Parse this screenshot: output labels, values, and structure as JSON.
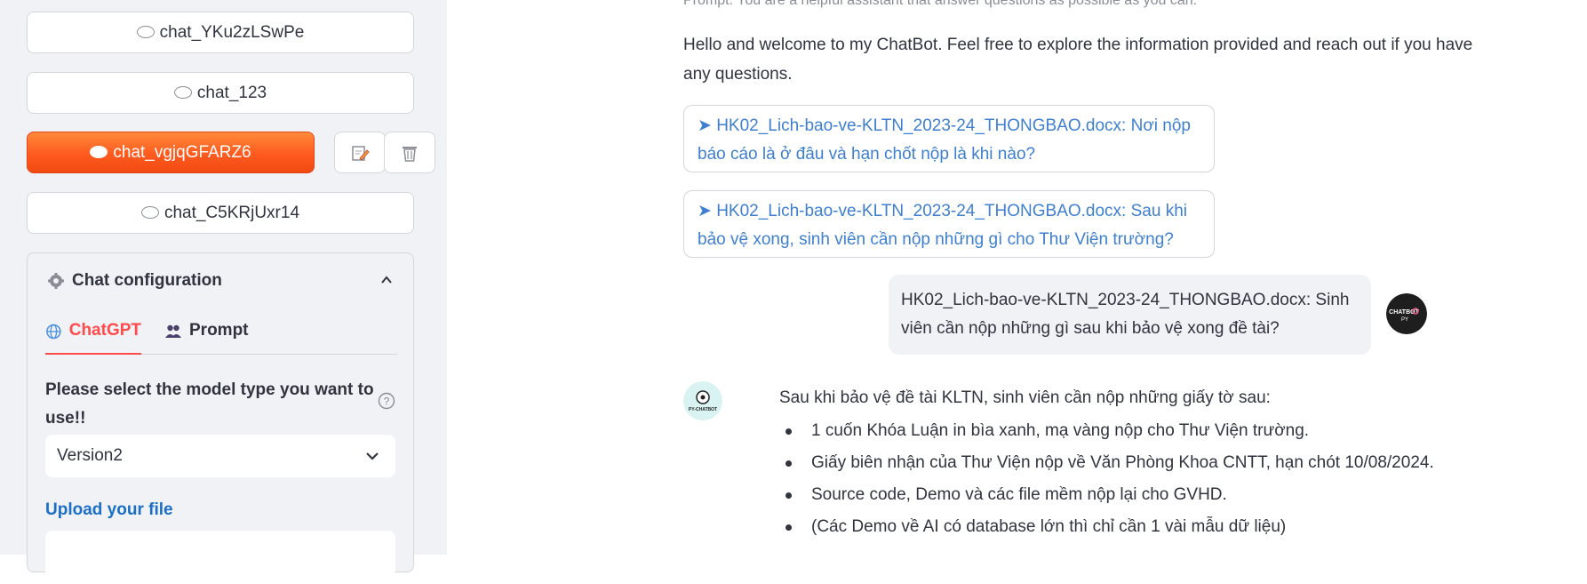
{
  "sidebar": {
    "chats": [
      {
        "label": "chat_YKu2zLSwPe",
        "active": false
      },
      {
        "label": "chat_123",
        "active": false
      },
      {
        "label": "chat_vgjqGFARZ6",
        "active": true
      },
      {
        "label": "chat_C5KRjUxr14",
        "active": false
      }
    ],
    "config": {
      "title": "Chat configuration",
      "tabs": [
        {
          "label": "ChatGPT",
          "icon": "globe-icon",
          "active": true
        },
        {
          "label": "Prompt",
          "icon": "users-icon",
          "active": false
        }
      ],
      "model_label": "Please select the model type you want to use!!",
      "model_value": "Version2",
      "upload_label": "Upload your file"
    }
  },
  "main": {
    "prompt_line": "Prompt: You are a helpful assistant that answer questions as possible as you can.",
    "welcome": "Hello and welcome to my ChatBot. Feel free to explore the information provided and reach out if you have any questions.",
    "suggestions": [
      "➤ HK02_Lich-bao-ve-KLTN_2023-24_THONGBAO.docx: Nơi nộp báo cáo là ở đâu và hạn chốt nộp là khi nào?",
      "➤ HK02_Lich-bao-ve-KLTN_2023-24_THONGBAO.docx: Sau khi bảo vệ xong, sinh viên cần nộp những gì cho Thư Viện trường?"
    ],
    "user_message": "HK02_Lich-bao-ve-KLTN_2023-24_THONGBAO.docx: Sinh viên cần nộp những gì sau khi bảo vệ xong đề tài?",
    "user_avatar_text": "CHATBOT PY",
    "bot_avatar_text": "PY-CHATBOT",
    "bot_intro": "Sau khi bảo vệ đề tài KLTN, sinh viên cần nộp những giấy tờ sau:",
    "bot_items": [
      "1 cuốn Khóa Luận in bìa xanh, mạ vàng nộp cho Thư Viện trường.",
      "Giấy biên nhận của Thư Viện nộp về Văn Phòng Khoa CNTT, hạn chót 10/08/2024.",
      "Source code, Demo và các file mềm nộp lại cho GVHD.",
      "(Các Demo về AI có database lớn thì chỉ cần 1 vài mẫu dữ liệu)"
    ]
  },
  "colors": {
    "accent": "#ff4b4b",
    "active_chat": "#ff6a2a",
    "link": "#3e7fcf",
    "upload_label": "#1c6fc6"
  }
}
